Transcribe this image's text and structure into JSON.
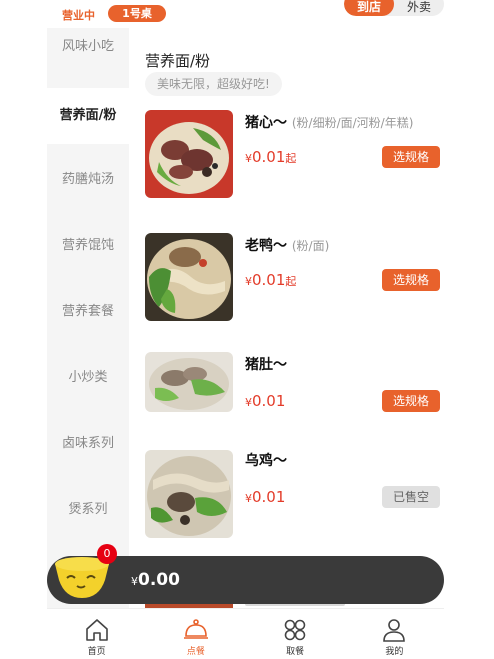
{
  "header": {
    "status": "营业中",
    "table": "1号桌",
    "modes": [
      "到店",
      "外卖"
    ]
  },
  "sidebar": {
    "items": [
      {
        "label": "风味小吃"
      },
      {
        "label": "营养面/粉",
        "active": true
      },
      {
        "label": "药膳炖汤"
      },
      {
        "label": "营养馄饨"
      },
      {
        "label": "营养套餐"
      },
      {
        "label": "小炒类"
      },
      {
        "label": "卤味系列"
      },
      {
        "label": "煲系列"
      }
    ]
  },
  "section": {
    "title": "营养面/粉",
    "subtitle": "美味无限，超级好吃!"
  },
  "products": [
    {
      "name": "猪心～",
      "spec": "(粉/细粉/面/河粉/年糕)",
      "currency": "¥",
      "price": "0.01",
      "suffix": "起",
      "button": "选规格",
      "sold_out": false
    },
    {
      "name": "老鸭～",
      "spec": "(粉/面)",
      "currency": "¥",
      "price": "0.01",
      "suffix": "起",
      "button": "选规格",
      "sold_out": false
    },
    {
      "name": "猪肚～",
      "spec": "",
      "currency": "¥",
      "price": "0.01",
      "suffix": "",
      "button": "选规格",
      "sold_out": false
    },
    {
      "name": "乌鸡～",
      "spec": "",
      "currency": "¥",
      "price": "0.01",
      "suffix": "",
      "button": "已售空",
      "sold_out": true
    }
  ],
  "cart": {
    "count": "0",
    "currency": "¥",
    "total": "0.00"
  },
  "tabbar": {
    "items": [
      {
        "label": "首页",
        "icon": "home-icon"
      },
      {
        "label": "点餐",
        "icon": "cloche-icon",
        "active": true
      },
      {
        "label": "取餐",
        "icon": "grid-icon"
      },
      {
        "label": "我的",
        "icon": "user-icon"
      }
    ]
  },
  "colors": {
    "accent": "#e8622c",
    "price": "#e33c2a",
    "cart_bar": "#3a3a3a",
    "badge": "#e60012"
  }
}
